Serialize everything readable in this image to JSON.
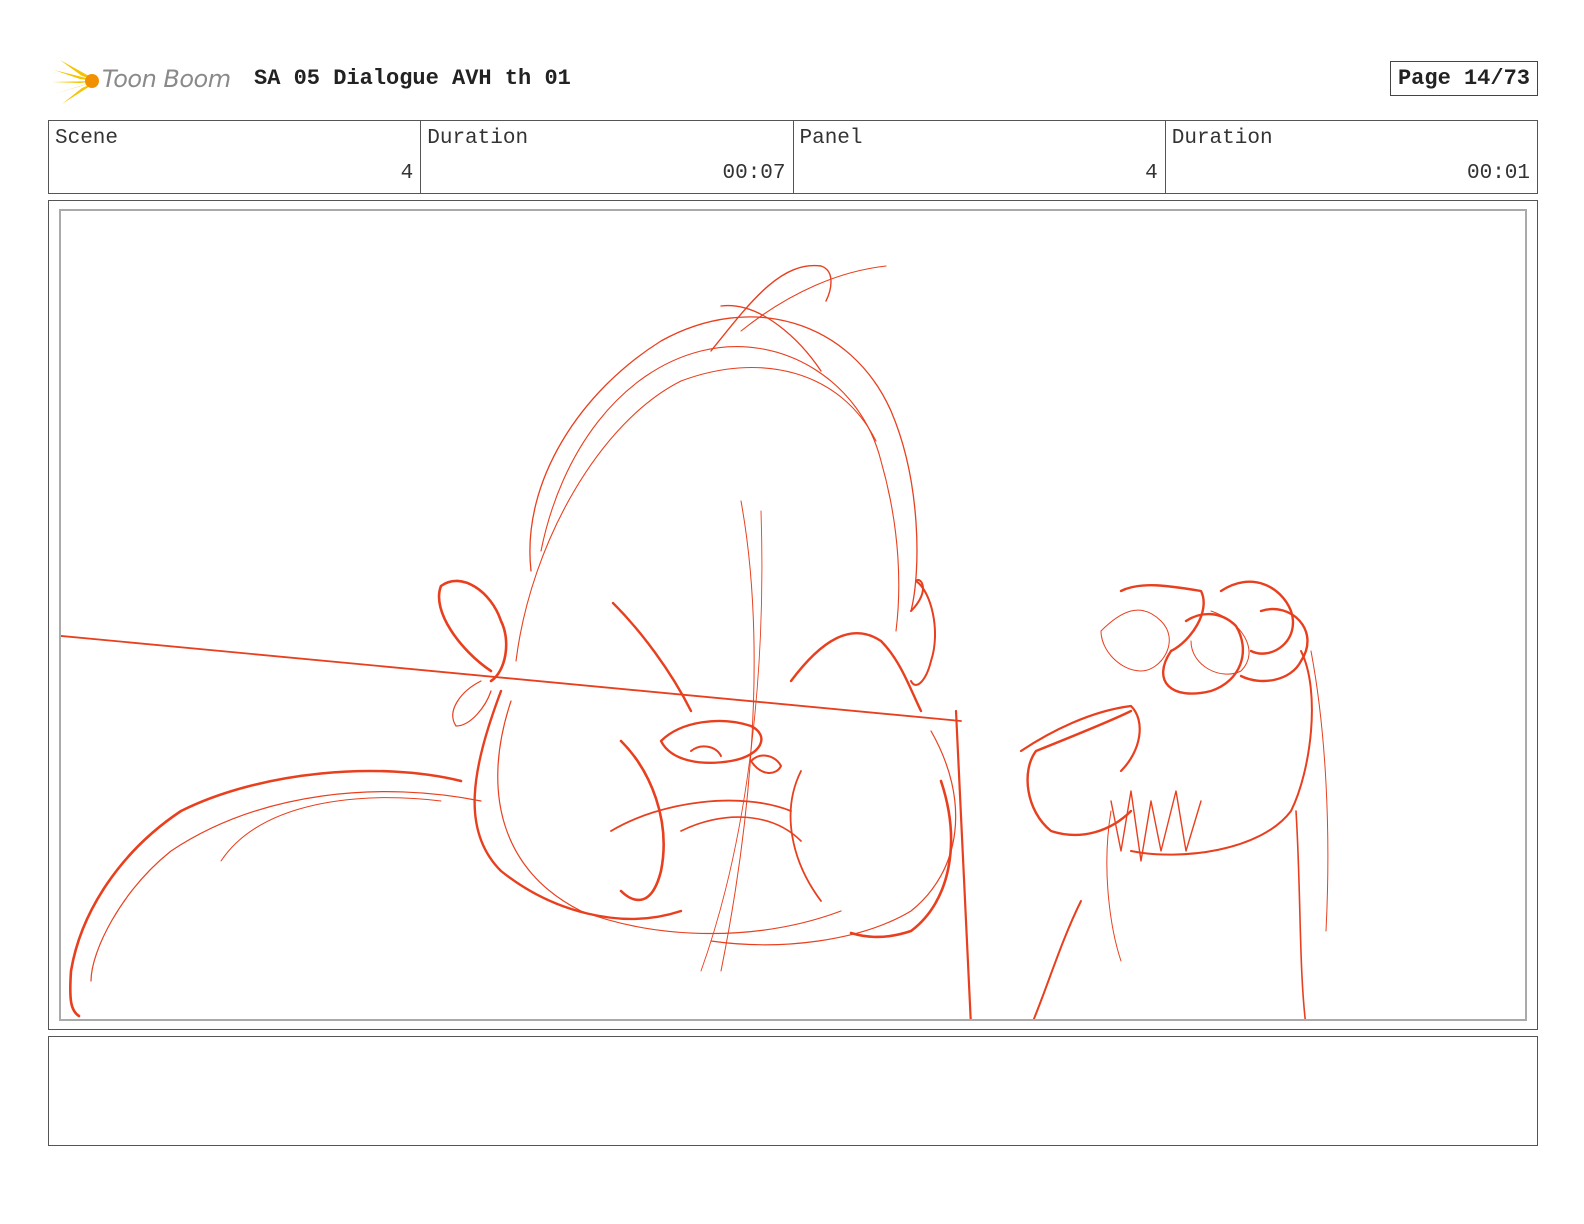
{
  "header": {
    "logo_text": "Toon Boom",
    "project_title": "SA 05 Dialogue AVH th 01",
    "page_label": "Page 14/73"
  },
  "info": {
    "scene_label": "Scene",
    "scene_value": "4",
    "scene_duration_label": "Duration",
    "scene_duration_value": "00:07",
    "panel_label": "Panel",
    "panel_value": "4",
    "panel_duration_label": "Duration",
    "panel_duration_value": "00:01"
  },
  "colors": {
    "sketch": "#e8401f",
    "logo_yellow": "#f5c400",
    "logo_orange": "#f29100"
  },
  "icons": {
    "logo": "starburst-icon"
  }
}
